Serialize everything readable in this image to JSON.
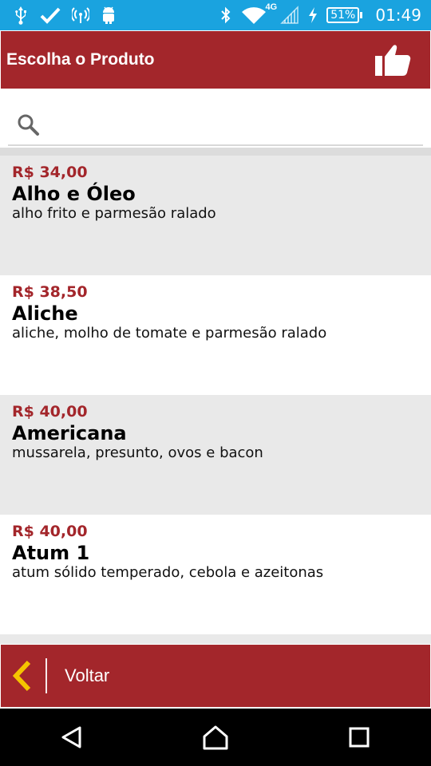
{
  "status_bar": {
    "left_icons": [
      "usb-icon",
      "check-icon",
      "wireless-icon",
      "android-icon"
    ],
    "right_icons": [
      "bluetooth-icon",
      "wifi-icon",
      "signal-icon",
      "charging-icon"
    ],
    "network_type": "4G",
    "battery_percent": "51%",
    "time": "01:49",
    "background_color": "#1aa3df"
  },
  "header": {
    "title": "Escolha o Produto",
    "action_icon": "thumbs-up-icon",
    "background_color": "#a3262b"
  },
  "search": {
    "icon": "search-icon",
    "value": "",
    "placeholder": ""
  },
  "products": [
    {
      "price": "R$ 34,00",
      "name": "Alho e Óleo",
      "description": "alho frito e parmesão ralado"
    },
    {
      "price": "R$ 38,50",
      "name": "Aliche",
      "description": "aliche, molho de tomate e parmesão ralado"
    },
    {
      "price": "R$ 40,00",
      "name": "Americana",
      "description": "mussarela, presunto, ovos e bacon"
    },
    {
      "price": "R$ 40,00",
      "name": "Atum 1",
      "description": "atum sólido temperado, cebola e azeitonas"
    }
  ],
  "bottom_bar": {
    "back_icon": "chevron-left-icon",
    "back_label": "Voltar",
    "accent_color": "#f5c400"
  },
  "nav_bar": {
    "buttons": [
      "back-triangle-icon",
      "home-icon",
      "recents-icon"
    ]
  }
}
